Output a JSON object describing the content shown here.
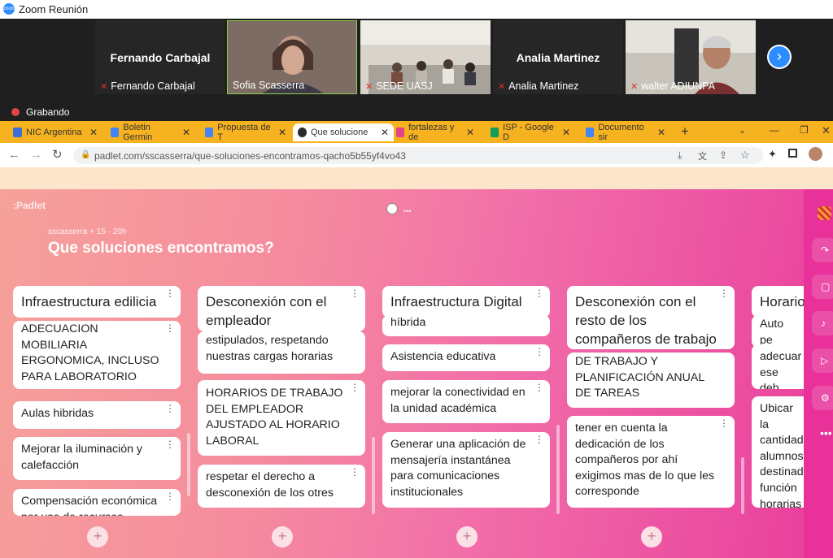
{
  "zoom": {
    "app_title": "Zoom Reunión",
    "participants": [
      {
        "big_name": "Fernando Carbajal",
        "label": "Fernando Carbajal",
        "muted": true,
        "video": false
      },
      {
        "big_name": "",
        "label": "Sofia Scasserra",
        "muted": false,
        "video": true
      },
      {
        "big_name": "",
        "label": "SEDE UASJ",
        "muted": true,
        "video": true
      },
      {
        "big_name": "Analia Martinez",
        "label": "Analia Martinez",
        "muted": true,
        "video": false
      },
      {
        "big_name": "",
        "label": "walter ADIUNPA",
        "muted": true,
        "video": true
      }
    ],
    "recording_label": "Grabando",
    "next_icon": "chevron-right-icon"
  },
  "browser": {
    "tabs": [
      {
        "label": "NIC Argentina",
        "color": "#3b6fd6"
      },
      {
        "label": "Boletin Germin",
        "color": "#4285f4"
      },
      {
        "label": "Propuesta de T",
        "color": "#4285f4"
      },
      {
        "label": "Que solucione",
        "color": "#2b2b2b"
      },
      {
        "label": "fortalezas y de",
        "color": "#e3458b"
      },
      {
        "label": "ISP - Google D",
        "color": "#0f9d58"
      },
      {
        "label": "Documento sir",
        "color": "#4285f4"
      }
    ],
    "url": "padlet.com/sscasserra/que-soluciones-encontramos-qacho5b55yf4vo43"
  },
  "padlet": {
    "brand": ":Padlet",
    "author_meta": "sscasserra + 15 · 20h",
    "title": "Que soluciones encontramos?",
    "columns": [
      {
        "header": "Infraestructura edilicia",
        "cards": [
          "ADECUACION MOBILIARIA ERGONOMICA, INCLUSO PARA LABORATORIO",
          "Aulas hibridas",
          "Mejorar la iluminación y calefacción",
          "Compensación económica por uso de recursos propios"
        ]
      },
      {
        "header": "Desconexión con el empleador",
        "cards": [
          "estipulados, respetando nuestras cargas horarias",
          "HORARIOS DE TRABAJO DEL EMPLEADOR AJUSTADO AL HORARIO LABORAL",
          "respetar el derecho a desconexión de los otres"
        ]
      },
      {
        "header": "Infraestructura Digital",
        "cards": [
          "híbrida",
          "Asistencia educativa",
          "mejorar la conectividad en la unidad académica",
          "Generar una aplicación de mensajería instantánea para comunicaciones institucionales"
        ]
      },
      {
        "header": "Desconexión con el resto de los compañeros de trabajo",
        "cards": [
          "DE TRABAJO Y PLANIFICACIÓN ANUAL DE TAREAS",
          "tener en cuenta la dedicación de los compañeros por ahí exigimos mas de lo que les corresponde"
        ]
      },
      {
        "header": "Horarios",
        "cards": [
          "Auto pe",
          "adecuar ese deb",
          "Ubicar la cantidad alumnos destinad función horarias"
        ]
      }
    ]
  }
}
